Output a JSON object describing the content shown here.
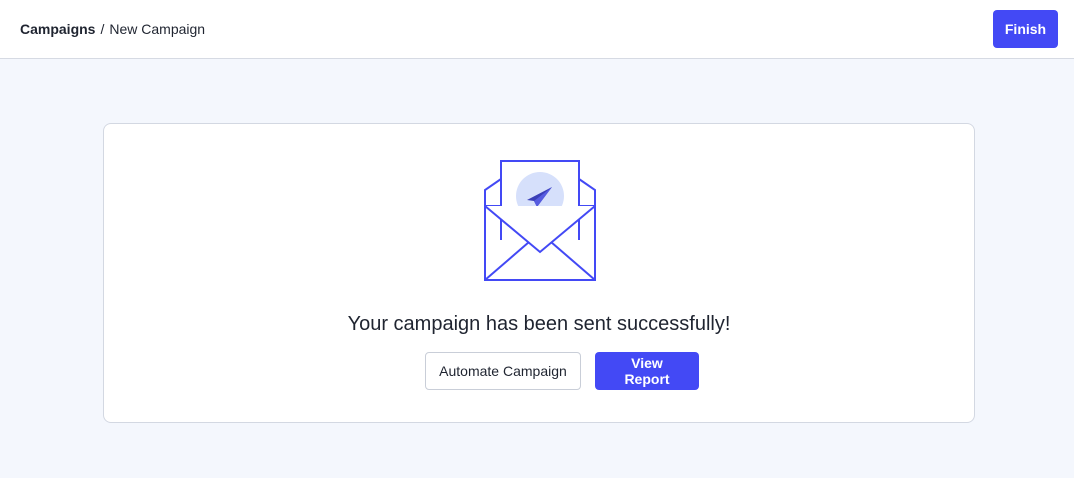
{
  "header": {
    "breadcrumb_root": "Campaigns",
    "breadcrumb_separator": "/",
    "breadcrumb_current": "New Campaign",
    "finish_label": "Finish"
  },
  "main": {
    "illustration_icon": "envelope-sent-icon",
    "success_message": "Your campaign has been sent successfully!",
    "automate_label": "Automate Campaign",
    "view_report_label": "View Report"
  },
  "colors": {
    "accent": "#4349f5",
    "background": "#f4f7fd",
    "illustration_circle": "#d6e0fb"
  }
}
